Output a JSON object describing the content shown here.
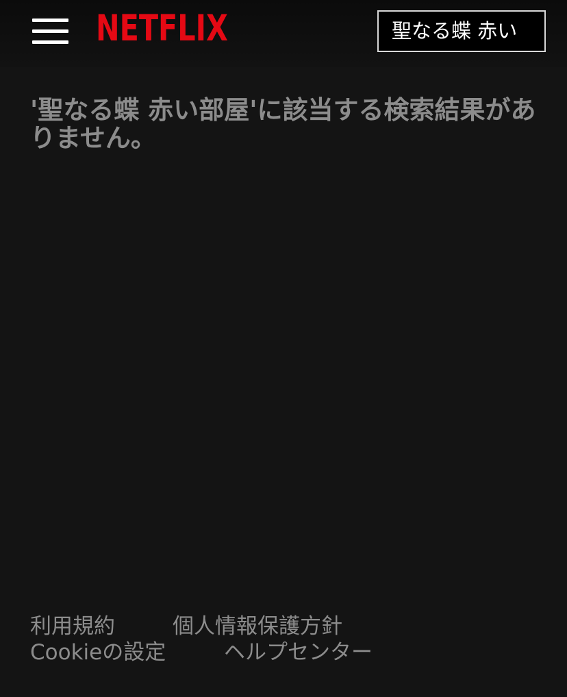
{
  "header": {
    "logo_text": "NETFLIX",
    "search": {
      "value": "聖なる蝶 赤い"
    }
  },
  "main": {
    "no_results_message": "'聖なる蝶 赤い部屋'に該当する検索結果がありません。"
  },
  "footer": {
    "links": [
      {
        "label": "利用規約"
      },
      {
        "label": "個人情報保護方針"
      },
      {
        "label": "Cookieの設定"
      },
      {
        "label": "ヘルプセンター"
      }
    ]
  },
  "colors": {
    "background": "#141414",
    "brand": "#e50914",
    "text_muted": "#8c8c8c"
  },
  "icons": [
    "menu-icon"
  ]
}
